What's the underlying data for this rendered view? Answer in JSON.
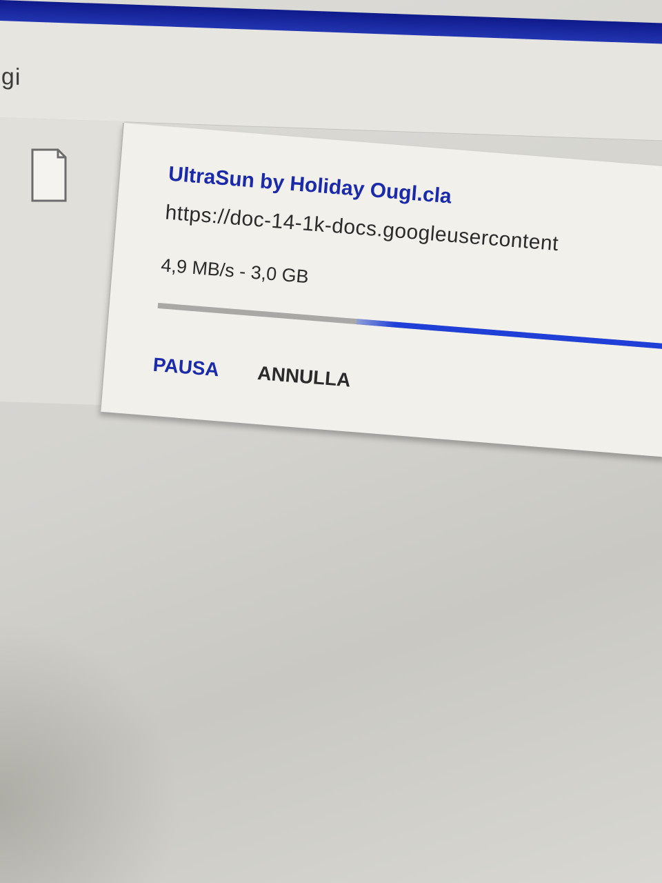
{
  "window": {
    "title_partial": "ggi"
  },
  "download": {
    "file_icon": "file-icon",
    "name": "UltraSun by Holiday Ougl.cla",
    "url": "https://doc-14-1k-docs.googleusercontent",
    "speed": "4,9 MB/s",
    "separator": "-",
    "size": "3,0 GB",
    "progress_fraction": 0.62,
    "accent_color": "#1f3fd6",
    "actions": {
      "pause_label": "PAUSA",
      "cancel_label": "ANNULLA"
    }
  }
}
